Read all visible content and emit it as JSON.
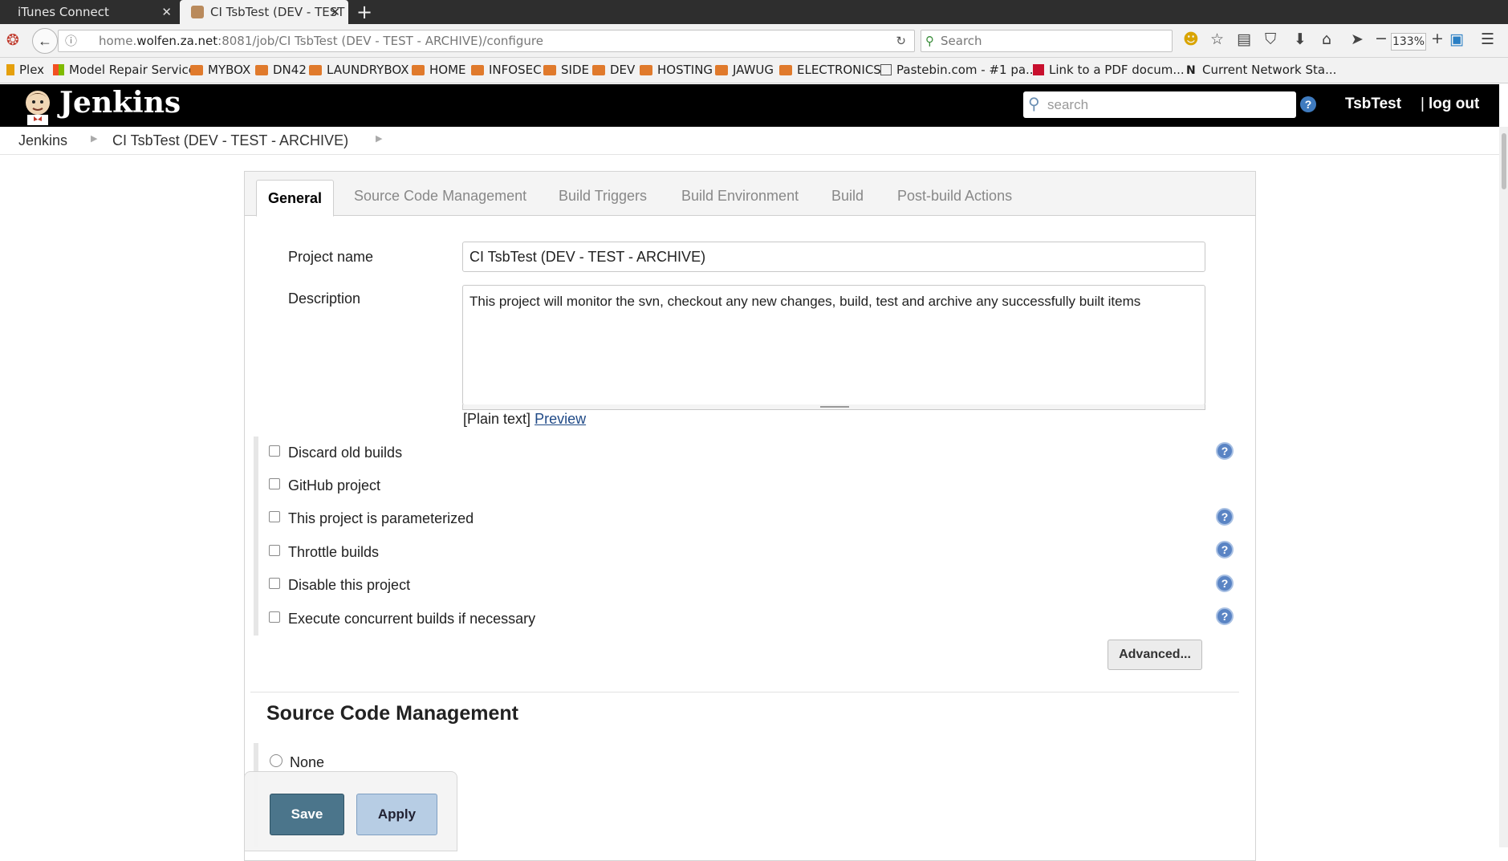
{
  "browser": {
    "tabs": [
      {
        "title": "iTunes Connect"
      },
      {
        "title": "CI TsbTest (DEV - TEST"
      }
    ],
    "url_prefix": "home.",
    "url_host": "wolfen.za.net",
    "url_rest": ":8081/job/CI TsbTest (DEV - TEST - ARCHIVE)/configure",
    "search_placeholder": "Search",
    "zoom": "133%",
    "bookmarks": [
      "Plex",
      "Model Repair Service",
      "MYBOX",
      "DN42",
      "LAUNDRYBOX",
      "HOME",
      "INFOSEC",
      "SIDE",
      "DEV",
      "HOSTING",
      "JAWUG",
      "ELECTRONICS",
      "Pastebin.com - #1 pa...",
      "Link to a PDF docum...",
      "Current Network Sta..."
    ]
  },
  "jenkins": {
    "title": "Jenkins",
    "search_placeholder": "search",
    "user": "TsbTest",
    "logout": "log out",
    "separator": "|",
    "breadcrumb": [
      "Jenkins",
      "CI TsbTest (DEV - TEST - ARCHIVE)"
    ]
  },
  "config": {
    "tabs": [
      "General",
      "Source Code Management",
      "Build Triggers",
      "Build Environment",
      "Build",
      "Post-build Actions"
    ],
    "project_name_label": "Project name",
    "project_name_value": "CI TsbTest (DEV - TEST - ARCHIVE)",
    "description_label": "Description",
    "description_value": "This project will monitor the svn, checkout any new changes, build, test and archive any successfully built items",
    "plain_text": "[Plain text]",
    "preview": "Preview",
    "options": [
      "Discard old builds",
      "GitHub project",
      "This project is parameterized",
      "Throttle builds",
      "Disable this project",
      "Execute concurrent builds if necessary"
    ],
    "advanced": "Advanced...",
    "scm_title": "Source Code Management",
    "scm_none": "None",
    "save": "Save",
    "apply": "Apply"
  }
}
